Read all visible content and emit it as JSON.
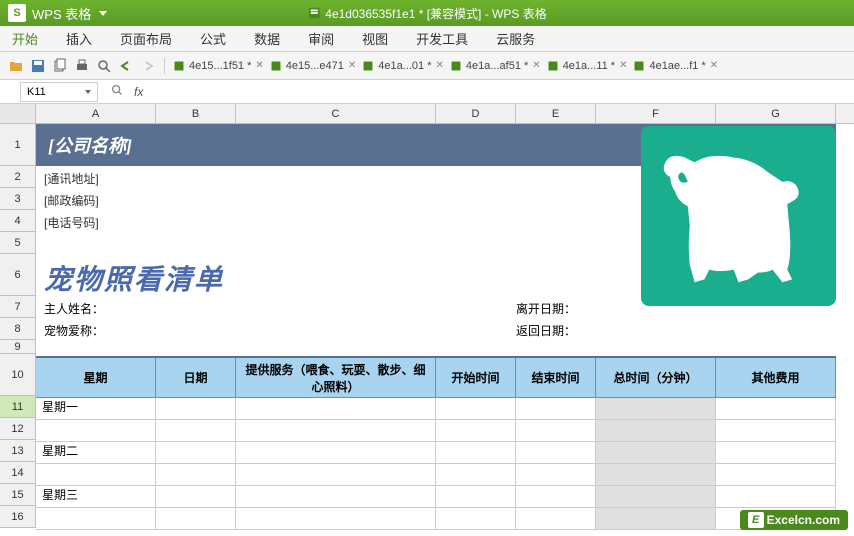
{
  "app": {
    "name": "WPS 表格",
    "doc_title": "4e1d036535f1e1 * [兼容模式] - WPS 表格"
  },
  "menu": {
    "items": [
      "开始",
      "插入",
      "页面布局",
      "公式",
      "数据",
      "审阅",
      "视图",
      "开发工具",
      "云服务"
    ],
    "active_index": 0
  },
  "tabs": [
    {
      "label": "4e15...1f51 *"
    },
    {
      "label": "4e15...e471"
    },
    {
      "label": "4e1a...01 *"
    },
    {
      "label": "4e1a...af51 *"
    },
    {
      "label": "4e1a...11 *"
    },
    {
      "label": "4e1ae...f1 *"
    }
  ],
  "formula": {
    "name_box": "K11",
    "fx": "fx"
  },
  "columns": [
    "A",
    "B",
    "C",
    "D",
    "E",
    "F",
    "G"
  ],
  "rows": [
    "1",
    "2",
    "3",
    "4",
    "5",
    "6",
    "7",
    "8",
    "9",
    "10",
    "11",
    "12",
    "13",
    "14",
    "15",
    "16"
  ],
  "selected_row": "11",
  "sheet": {
    "company": "[公司名称]",
    "address": "[通讯地址]",
    "postal": "[邮政编码]",
    "phone": "[电话号码]",
    "title": "宠物照看清单",
    "owner_label": "主人姓名：",
    "pet_label": "宠物爱称：",
    "leave_label": "离开日期：",
    "return_label": "返回日期："
  },
  "table": {
    "headers": [
      "星期",
      "日期",
      "提供服务（喂食、玩耍、散步、细心照料）",
      "开始时间",
      "结束时间",
      "总时间（分钟）",
      "其他费用"
    ],
    "days": [
      "星期一",
      "星期二",
      "星期三"
    ]
  },
  "watermark": {
    "badge": "E",
    "text": "Excelcn.com"
  }
}
